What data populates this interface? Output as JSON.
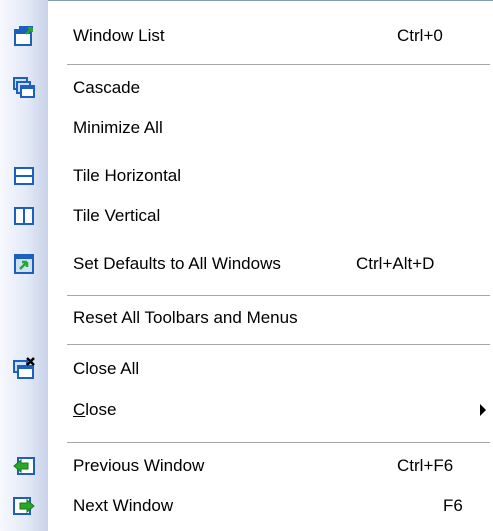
{
  "menu": {
    "items": [
      {
        "label": "Window List",
        "shortcut": "Ctrl+0",
        "icon": "window-list-icon"
      },
      {
        "label": "Cascade",
        "icon": "cascade-icon"
      },
      {
        "label": "Minimize All"
      },
      {
        "label": "Tile Horizontal",
        "icon": "tile-horizontal-icon"
      },
      {
        "label": "Tile Vertical",
        "icon": "tile-vertical-icon"
      },
      {
        "label": "Set Defaults to All Windows",
        "shortcut": "Ctrl+Alt+D",
        "icon": "set-defaults-icon"
      },
      {
        "label": "Reset All Toolbars and Menus"
      },
      {
        "label": "Close All",
        "icon": "close-all-icon"
      },
      {
        "label_first": "C",
        "label_rest": "lose",
        "submenu": true
      },
      {
        "label": "Previous Window",
        "shortcut": "Ctrl+F6",
        "icon": "previous-window-icon"
      },
      {
        "label": "Next Window",
        "shortcut": "F6",
        "icon": "next-window-icon"
      }
    ]
  },
  "colors": {
    "icon_blue": "#1c5fbf",
    "icon_fill": "#cfe0f7",
    "arrow_green": "#28a828",
    "separator": "#a6a6a6"
  }
}
